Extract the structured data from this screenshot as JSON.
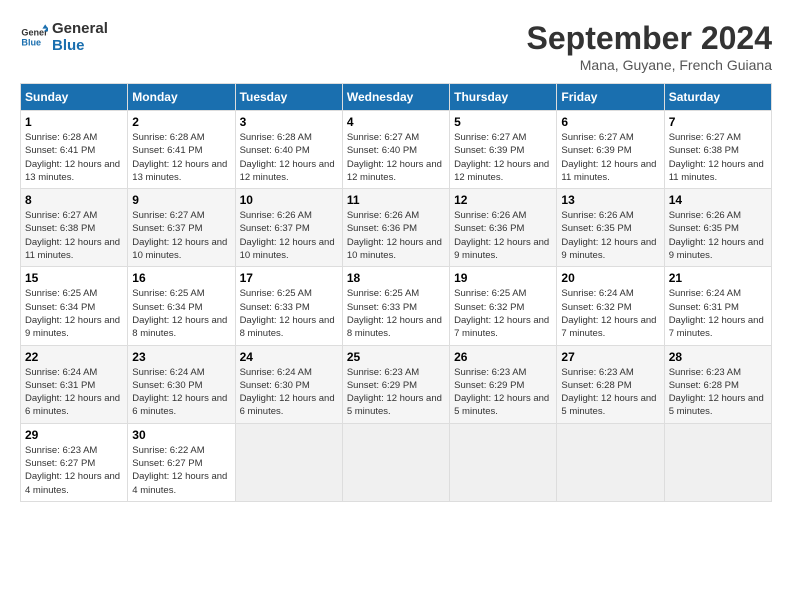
{
  "header": {
    "logo_line1": "General",
    "logo_line2": "Blue",
    "month_year": "September 2024",
    "location": "Mana, Guyane, French Guiana"
  },
  "days_of_week": [
    "Sunday",
    "Monday",
    "Tuesday",
    "Wednesday",
    "Thursday",
    "Friday",
    "Saturday"
  ],
  "weeks": [
    [
      {
        "day": "1",
        "sunrise": "6:28 AM",
        "sunset": "6:41 PM",
        "daylight": "12 hours and 13 minutes."
      },
      {
        "day": "2",
        "sunrise": "6:28 AM",
        "sunset": "6:41 PM",
        "daylight": "12 hours and 13 minutes."
      },
      {
        "day": "3",
        "sunrise": "6:28 AM",
        "sunset": "6:40 PM",
        "daylight": "12 hours and 12 minutes."
      },
      {
        "day": "4",
        "sunrise": "6:27 AM",
        "sunset": "6:40 PM",
        "daylight": "12 hours and 12 minutes."
      },
      {
        "day": "5",
        "sunrise": "6:27 AM",
        "sunset": "6:39 PM",
        "daylight": "12 hours and 12 minutes."
      },
      {
        "day": "6",
        "sunrise": "6:27 AM",
        "sunset": "6:39 PM",
        "daylight": "12 hours and 11 minutes."
      },
      {
        "day": "7",
        "sunrise": "6:27 AM",
        "sunset": "6:38 PM",
        "daylight": "12 hours and 11 minutes."
      }
    ],
    [
      {
        "day": "8",
        "sunrise": "6:27 AM",
        "sunset": "6:38 PM",
        "daylight": "12 hours and 11 minutes."
      },
      {
        "day": "9",
        "sunrise": "6:27 AM",
        "sunset": "6:37 PM",
        "daylight": "12 hours and 10 minutes."
      },
      {
        "day": "10",
        "sunrise": "6:26 AM",
        "sunset": "6:37 PM",
        "daylight": "12 hours and 10 minutes."
      },
      {
        "day": "11",
        "sunrise": "6:26 AM",
        "sunset": "6:36 PM",
        "daylight": "12 hours and 10 minutes."
      },
      {
        "day": "12",
        "sunrise": "6:26 AM",
        "sunset": "6:36 PM",
        "daylight": "12 hours and 9 minutes."
      },
      {
        "day": "13",
        "sunrise": "6:26 AM",
        "sunset": "6:35 PM",
        "daylight": "12 hours and 9 minutes."
      },
      {
        "day": "14",
        "sunrise": "6:26 AM",
        "sunset": "6:35 PM",
        "daylight": "12 hours and 9 minutes."
      }
    ],
    [
      {
        "day": "15",
        "sunrise": "6:25 AM",
        "sunset": "6:34 PM",
        "daylight": "12 hours and 9 minutes."
      },
      {
        "day": "16",
        "sunrise": "6:25 AM",
        "sunset": "6:34 PM",
        "daylight": "12 hours and 8 minutes."
      },
      {
        "day": "17",
        "sunrise": "6:25 AM",
        "sunset": "6:33 PM",
        "daylight": "12 hours and 8 minutes."
      },
      {
        "day": "18",
        "sunrise": "6:25 AM",
        "sunset": "6:33 PM",
        "daylight": "12 hours and 8 minutes."
      },
      {
        "day": "19",
        "sunrise": "6:25 AM",
        "sunset": "6:32 PM",
        "daylight": "12 hours and 7 minutes."
      },
      {
        "day": "20",
        "sunrise": "6:24 AM",
        "sunset": "6:32 PM",
        "daylight": "12 hours and 7 minutes."
      },
      {
        "day": "21",
        "sunrise": "6:24 AM",
        "sunset": "6:31 PM",
        "daylight": "12 hours and 7 minutes."
      }
    ],
    [
      {
        "day": "22",
        "sunrise": "6:24 AM",
        "sunset": "6:31 PM",
        "daylight": "12 hours and 6 minutes."
      },
      {
        "day": "23",
        "sunrise": "6:24 AM",
        "sunset": "6:30 PM",
        "daylight": "12 hours and 6 minutes."
      },
      {
        "day": "24",
        "sunrise": "6:24 AM",
        "sunset": "6:30 PM",
        "daylight": "12 hours and 6 minutes."
      },
      {
        "day": "25",
        "sunrise": "6:23 AM",
        "sunset": "6:29 PM",
        "daylight": "12 hours and 5 minutes."
      },
      {
        "day": "26",
        "sunrise": "6:23 AM",
        "sunset": "6:29 PM",
        "daylight": "12 hours and 5 minutes."
      },
      {
        "day": "27",
        "sunrise": "6:23 AM",
        "sunset": "6:28 PM",
        "daylight": "12 hours and 5 minutes."
      },
      {
        "day": "28",
        "sunrise": "6:23 AM",
        "sunset": "6:28 PM",
        "daylight": "12 hours and 5 minutes."
      }
    ],
    [
      {
        "day": "29",
        "sunrise": "6:23 AM",
        "sunset": "6:27 PM",
        "daylight": "12 hours and 4 minutes."
      },
      {
        "day": "30",
        "sunrise": "6:22 AM",
        "sunset": "6:27 PM",
        "daylight": "12 hours and 4 minutes."
      },
      null,
      null,
      null,
      null,
      null
    ]
  ]
}
